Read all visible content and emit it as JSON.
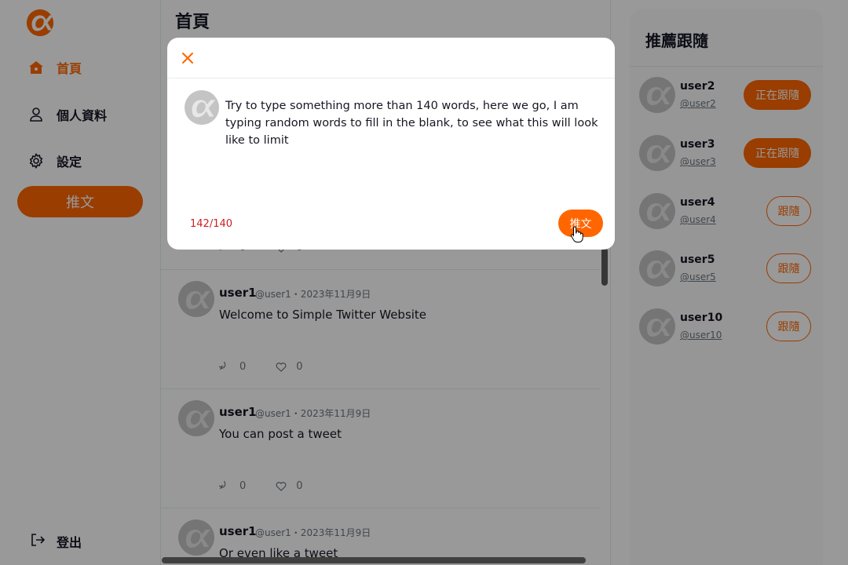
{
  "sidebar": {
    "nav": [
      {
        "label": "首頁",
        "icon": "home-icon"
      },
      {
        "label": "個人資料",
        "icon": "user-icon"
      },
      {
        "label": "設定",
        "icon": "gear-icon"
      }
    ],
    "tweet_button": "推文",
    "logout_label": "登出"
  },
  "main": {
    "title": "首頁",
    "partial_counts": {
      "reply": "0",
      "like": "0"
    },
    "tweets": [
      {
        "name": "user1",
        "meta": "@user1・2023年11月9日",
        "text": "Welcome to Simple Twitter Website",
        "replies": "0",
        "likes": "0"
      },
      {
        "name": "user1",
        "meta": "@user1・2023年11月9日",
        "text": "You can post a tweet",
        "replies": "0",
        "likes": "0"
      },
      {
        "name": "user1",
        "meta": "@user1・2023年11月9日",
        "text": "Or even like a tweet",
        "replies": "",
        "likes": ""
      }
    ]
  },
  "right": {
    "title": "推薦跟隨",
    "users": [
      {
        "name": "user2",
        "handle": "@user2",
        "button": "正在跟隨",
        "following": true
      },
      {
        "name": "user3",
        "handle": "@user3",
        "button": "正在跟隨",
        "following": true
      },
      {
        "name": "user4",
        "handle": "@user4",
        "button": "跟隨",
        "following": false
      },
      {
        "name": "user5",
        "handle": "@user5",
        "button": "跟隨",
        "following": false
      },
      {
        "name": "user10",
        "handle": "@user10",
        "button": "跟隨",
        "following": false
      }
    ]
  },
  "modal": {
    "text": "Try to type something more than 140 words, here we go, I am typing random words to fill in the blank, to see what this will look like to limit",
    "counter": "142/140",
    "submit_label": "推文",
    "close_icon": "close-icon"
  },
  "colors": {
    "accent": "#FF6600",
    "error": "#CC1F1F",
    "avatar": "#C4C4C4"
  }
}
